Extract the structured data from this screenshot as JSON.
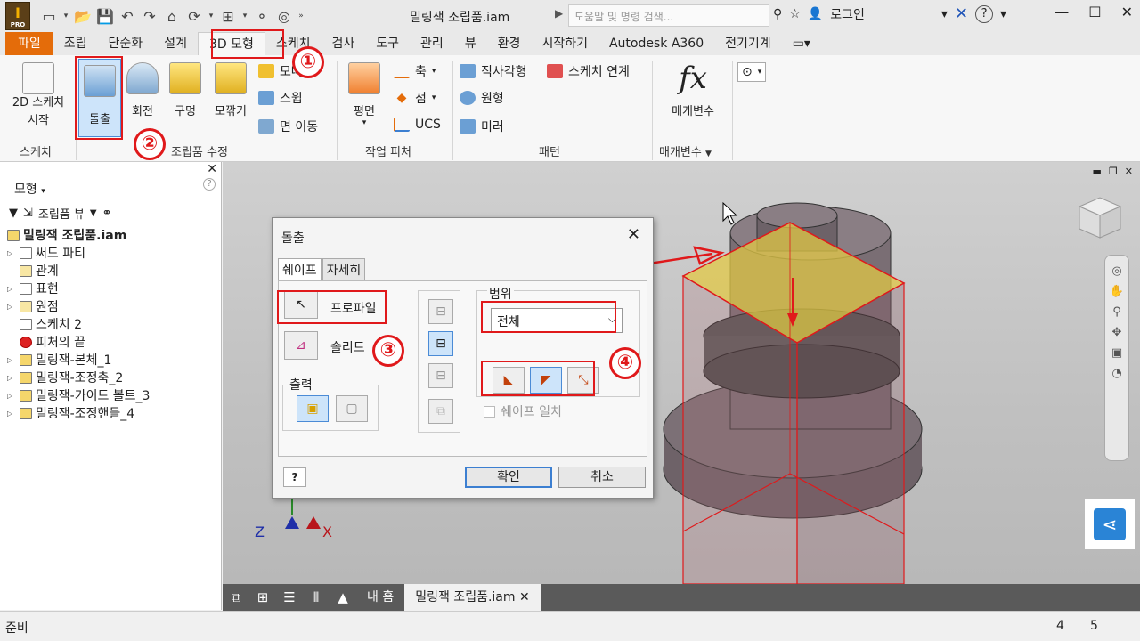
{
  "title_bar": {
    "doc_title": "밀링잭 조립품.iam",
    "search_placeholder": "도움말 및 명령 검색...",
    "login": "로그인",
    "help": "?"
  },
  "menu_tabs": [
    "파일",
    "조립",
    "단순화",
    "설계",
    "3D 모형",
    "스케치",
    "검사",
    "도구",
    "관리",
    "뷰",
    "환경",
    "시작하기",
    "Autodesk A360",
    "전기기계"
  ],
  "ribbon": {
    "sketch_start": "2D 스케치\n시작",
    "extrude": "돌출",
    "revolve": "회전",
    "hole": "구멍",
    "chamfer": "모깎기",
    "chamfer2": "모따기",
    "sweep": "스윕",
    "move_face": "면 이동",
    "plane": "평면",
    "axis": "축",
    "point": "점",
    "ucs": "UCS",
    "rect_pattern": "직사각형",
    "circ_pattern": "원형",
    "mirror": "미러",
    "sketch_link": "스케치 연계",
    "parameters": "매개변수",
    "groups": {
      "sketch": "스케치",
      "modify": "조립품 수정",
      "work": "작업 피처",
      "pattern": "패턴",
      "param": "매개변수"
    }
  },
  "model_panel": {
    "title": "모형",
    "view": "조립품 뷰",
    "items": [
      {
        "label": "밀링잭 조립품.iam",
        "bold": true
      },
      {
        "label": "써드 파티"
      },
      {
        "label": "관계"
      },
      {
        "label": "표현"
      },
      {
        "label": "원점"
      },
      {
        "label": "스케치 2"
      },
      {
        "label": "피처의 끝"
      },
      {
        "label": "밀링잭-본체_1"
      },
      {
        "label": "밀링잭-조정축_2"
      },
      {
        "label": "밀링잭-가이드 볼트_3"
      },
      {
        "label": "밀링잭-조정핸들_4"
      }
    ]
  },
  "dialog": {
    "title": "돌출",
    "tab_shape": "쉐이프",
    "tab_more": "자세히",
    "profile": "프로파일",
    "solid": "솔리드",
    "output": "출력",
    "extents": "범위",
    "extents_value": "전체",
    "match_shape": "쉐이프 일치",
    "ok": "확인",
    "cancel": "취소"
  },
  "annotations": [
    "①",
    "②",
    "③",
    "④"
  ],
  "doc_tabs": {
    "home": "내 홈",
    "doc": "밀링잭 조립품.iam"
  },
  "axes": {
    "z": "Z",
    "x": "X"
  },
  "status": {
    "left": "준비",
    "n1": "4",
    "n2": "5"
  },
  "colors": {
    "file_tab": "#e46c0a",
    "annotation": "#e0191b",
    "selection": "#cde4fa"
  }
}
